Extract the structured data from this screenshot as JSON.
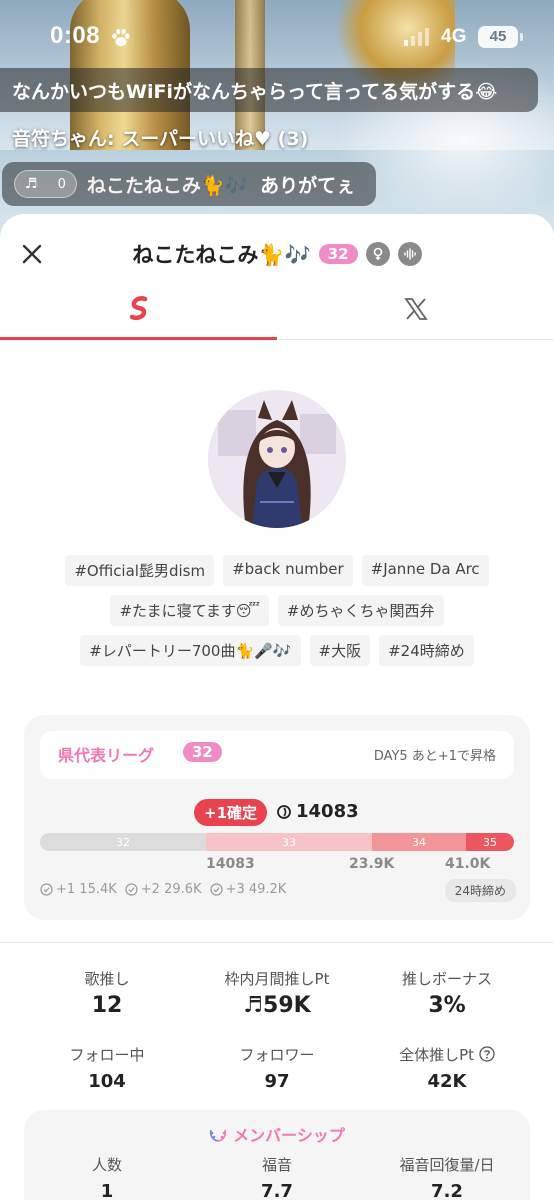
{
  "status_bar": {
    "time": "0:08",
    "network": "4G",
    "battery": "45"
  },
  "chat": [
    {
      "text": "なんかいつもWiFiがなんちゃらって言ってる気がする😂"
    },
    {
      "text": "音符ちゃん: スーパーいいね♥ (3)"
    },
    {
      "pill_count": "0",
      "name": "ねこたねこみ🐈🎶",
      "text": "ありがてぇ"
    }
  ],
  "profile": {
    "name": "ねこたねこみ🐈🎶",
    "level": "32",
    "tags": [
      [
        "#Official髭男dism",
        "#back number",
        "#Janne Da Arc"
      ],
      [
        "#たまに寝てます😴",
        "#めちゃくちゃ関西弁"
      ],
      [
        "#レパートリー700曲🐈🎤🎶",
        "#大阪",
        "#24時締め"
      ]
    ]
  },
  "league": {
    "name": "県代表リーグ",
    "level": "32",
    "day_text": "DAY5 あと+1で昇格",
    "confirm_label": "+1確定",
    "score": "14083",
    "bar_segments": [
      "32",
      "33",
      "34",
      "35"
    ],
    "bar_marks": [
      "14083",
      "23.9K",
      "41.0K"
    ],
    "thresholds": [
      "+1 15.4K",
      "+2 29.6K",
      "+3 49.2K"
    ],
    "deadline": "24時締め",
    "progress": 0.346
  },
  "stats": {
    "song_oshi": {
      "label": "歌推し",
      "value": "12"
    },
    "monthly_pt": {
      "label": "枠内月間推しPt",
      "value": "♬59K"
    },
    "bonus": {
      "label": "推しボーナス",
      "value": "3%"
    },
    "following": {
      "label": "フォロー中",
      "value": "104"
    },
    "followers": {
      "label": "フォロワー",
      "value": "97"
    },
    "total_pt": {
      "label": "全体推しPt",
      "value": "42K"
    }
  },
  "membership": {
    "title": "メンバーシップ",
    "members": {
      "label": "人数",
      "value": "1"
    },
    "fukuon": {
      "label": "福音",
      "value": "7.7"
    },
    "recovery": {
      "label": "福音回復量/日",
      "value": "7.2"
    }
  },
  "colors": {
    "accent_red": "#e8434f",
    "accent_pink": "#f08bc6",
    "league_pink": "#ef78b6"
  }
}
